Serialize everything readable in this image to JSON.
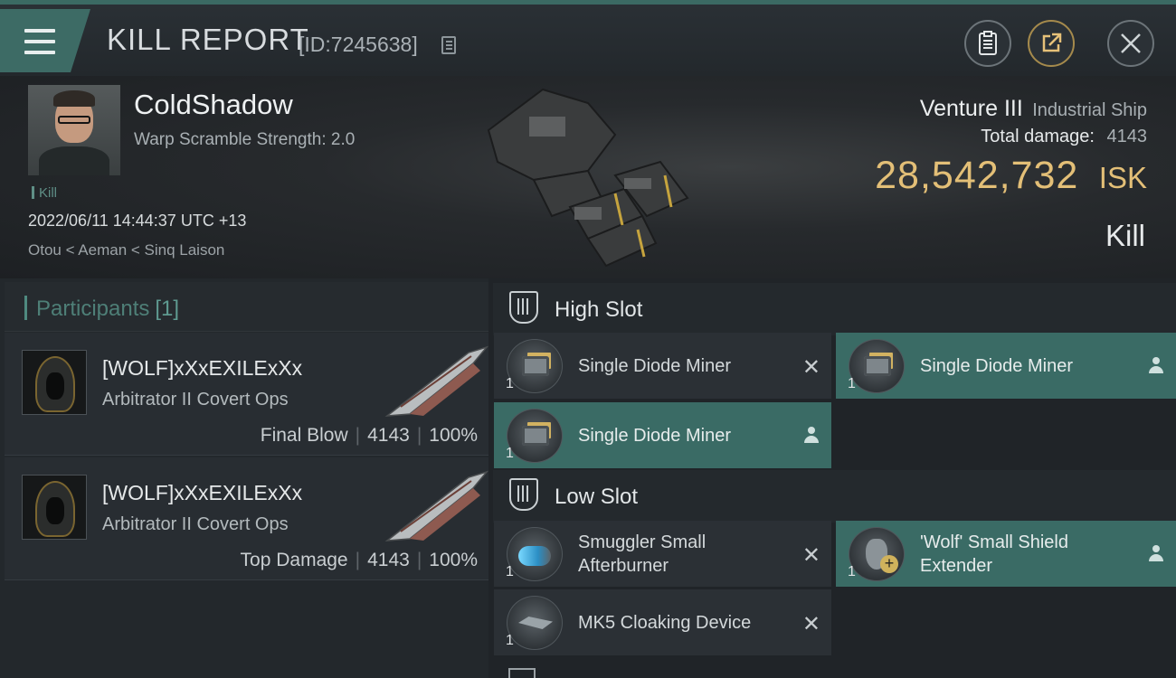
{
  "header": {
    "title": "KILL REPORT",
    "report_id": "[ID:7245638]",
    "menu_icon": "hamburger-menu-icon",
    "report_button_icon": "clipboard-icon",
    "share_button_icon": "share-icon",
    "close_icon": "close-icon"
  },
  "victim": {
    "name": "ColdShadow",
    "warp_scramble": "Warp Scramble Strength: 2.0",
    "tag": "Kill",
    "datetime": "2022/06/11 14:44:37 UTC +13",
    "location": "Otou < Aeman < Sinq Laison",
    "ship_name": "Venture III",
    "ship_class": "Industrial Ship",
    "total_damage_label": "Total damage:",
    "total_damage": "4143",
    "isk_value": "28,542,732",
    "isk_unit": "ISK",
    "result": "Kill"
  },
  "participants": {
    "title": "Participants",
    "count": "[1]",
    "rows": [
      {
        "name": "[WOLF]xXxEXILExXx",
        "ship": "Arbitrator II Covert Ops",
        "role": "Final Blow",
        "damage": "4143",
        "percent": "100%"
      },
      {
        "name": "[WOLF]xXxEXILExXx",
        "ship": "Arbitrator II Covert Ops",
        "role": "Top Damage",
        "damage": "4143",
        "percent": "100%"
      }
    ]
  },
  "fitting": {
    "high_slot_title": "High Slot",
    "low_slot_title": "Low Slot",
    "high": [
      {
        "name": "Single Diode Miner",
        "qty": "1",
        "status": "destroyed"
      },
      {
        "name": "Single Diode Miner",
        "qty": "1",
        "status": "dropped"
      },
      {
        "name": "Single Diode Miner",
        "qty": "1",
        "status": "dropped"
      }
    ],
    "low": [
      {
        "name": "Smuggler Small Afterburner",
        "qty": "1",
        "status": "destroyed"
      },
      {
        "name": "'Wolf' Small Shield Extender",
        "qty": "1",
        "status": "dropped"
      },
      {
        "name": "MK5 Cloaking Device",
        "qty": "1",
        "status": "destroyed"
      }
    ],
    "destroyed_mark": "✕"
  },
  "colors": {
    "accent": "#3d6b65",
    "isk": "#e3bf77",
    "dropped_bg": "#3a6b65",
    "panel": "#2b3035"
  }
}
